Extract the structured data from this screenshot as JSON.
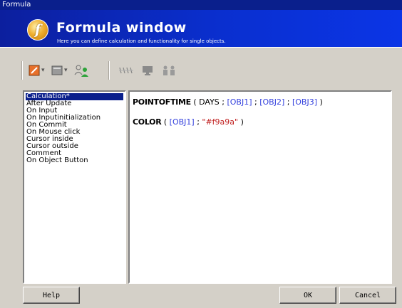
{
  "window": {
    "title": "Formula"
  },
  "header": {
    "logo_letter": "f",
    "title": "Formula window",
    "subtitle": "Here you can define calculation and functionality for single objects."
  },
  "toolbar": {
    "icons": [
      "color-picker-icon",
      "frame-icon",
      "users-icon",
      "glasses-icon",
      "monitor-icon",
      "people-icon"
    ],
    "colors": {
      "orange": "#e8702a",
      "green": "#2da33a"
    }
  },
  "events": {
    "items": [
      {
        "label": "Calculation*",
        "selected": true
      },
      {
        "label": "After Update",
        "selected": false
      },
      {
        "label": "On Input",
        "selected": false
      },
      {
        "label": "On Inputinitialization",
        "selected": false
      },
      {
        "label": "On Commit",
        "selected": false
      },
      {
        "label": "On Mouse click",
        "selected": false
      },
      {
        "label": "Cursor inside",
        "selected": false
      },
      {
        "label": "Cursor outside",
        "selected": false
      },
      {
        "label": "Comment",
        "selected": false
      },
      {
        "label": "On Object Button",
        "selected": false
      }
    ]
  },
  "formula": {
    "line1": {
      "fn": "POINTOFTIME",
      "open": " ( DAYS ; ",
      "arg1": "[OBJ1]",
      "sep1": " ; ",
      "arg2": "[OBJ2]",
      "sep2": " ; ",
      "arg3": "[OBJ3]",
      "close": " )"
    },
    "line2": {
      "fn": "COLOR",
      "open": " ( ",
      "arg1": "[OBJ1]",
      "sep1": " ; ",
      "str": "\"#f9a9a\"",
      "close": " )"
    },
    "colors": {
      "keyword": "#000000",
      "object": "#3340dd",
      "string": "#c02020"
    }
  },
  "buttons": {
    "help": "Help",
    "ok": "OK",
    "cancel": "Cancel"
  }
}
